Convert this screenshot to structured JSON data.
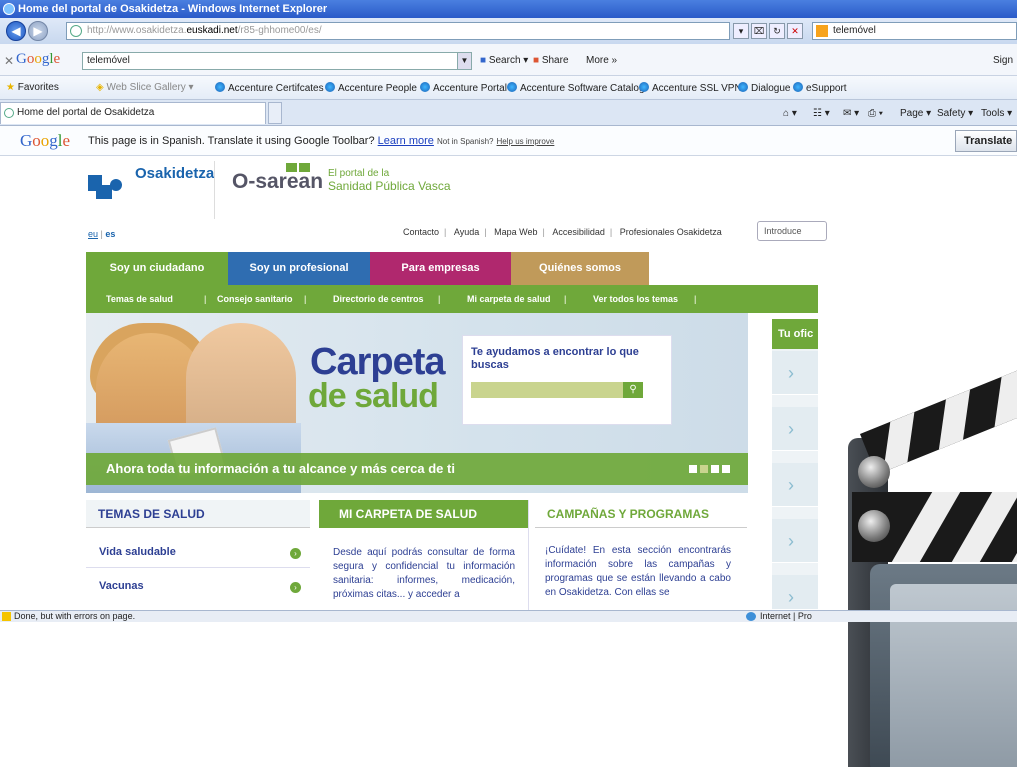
{
  "browser": {
    "title": "Home del portal de Osakidetza - Windows Internet Explorer",
    "url_prefix": "http://www.osakidetza.",
    "url_domain": "euskadi.net",
    "url_suffix": "/r85-ghhome00/es/",
    "search_value": "telemóvel",
    "tab_title": "Home del portal de Osakidetza",
    "status_text": "Done, but with errors on page.",
    "status_zone": "Internet | Pro"
  },
  "google_toolbar": {
    "logo": "Google",
    "query": "telemóvel",
    "search_label": "Search ▾",
    "share_label": "Share",
    "more_label": "More »",
    "sign_label": "Sign"
  },
  "favorites": {
    "label": "Favorites",
    "items": [
      "Web Slice Gallery ▾",
      "Accenture Certifcates",
      "Accenture People",
      "Accenture Portal",
      "Accenture Software Catalog",
      "Accenture SSL VPN",
      "Dialogue",
      "eSupport"
    ]
  },
  "command_bar": {
    "page": "Page ▾",
    "safety": "Safety ▾",
    "tools": "Tools ▾"
  },
  "translate_bar": {
    "logo": "Google",
    "message": "This page is in Spanish.  Translate it using Google Toolbar?",
    "learn_more": "Learn more",
    "not_spanish": "Not in Spanish?",
    "help": "Help us improve",
    "button": "Translate"
  },
  "portal": {
    "brand": "Osakidetza",
    "osarean": "O-sarean",
    "tag_line1": "El portal de la",
    "tag_line2": "Sanidad Pública Vasca",
    "lang_eu": "eu",
    "lang_es": "es",
    "top_links": [
      "Contacto",
      "Ayuda",
      "Mapa Web",
      "Accesibilidad",
      "Profesionales Osakidetza"
    ],
    "search_placeholder": "Introduce",
    "main_nav": [
      {
        "label": "Soy un ciudadano",
        "color": "#6fa83a"
      },
      {
        "label": "Soy un profesional",
        "color": "#2f6db1"
      },
      {
        "label": "Para empresas",
        "color": "#b0286e"
      },
      {
        "label": "Quiénes somos",
        "color": "#c09a5a"
      }
    ],
    "sub_nav": [
      "Temas de salud",
      "Consejo sanitario",
      "Directorio de centros",
      "Mi carpeta de salud",
      "Ver todos los temas"
    ],
    "hero": {
      "title_line1": "Carpeta",
      "title_line2": "de salud",
      "search_title": "Te ayudamos a encontrar lo que buscas",
      "band_text": "Ahora toda tu información a tu alcance y más cerca de ti"
    },
    "sidebar_title": "Tu ofic",
    "columns": {
      "temas": "TEMAS DE SALUD",
      "carpeta": "MI CARPETA DE SALUD",
      "campanas": "CAMPAÑAS Y PROGRAMAS"
    },
    "topics": [
      "Vida saludable",
      "Vacunas"
    ],
    "carpeta_text": "Desde aquí podrás consultar de forma segura y confidencial tu información sanitaria: informes, medicación, próximas citas... y acceder a",
    "campanas_text": "¡Cuídate! En esta sección encontrarás información sobre las campañas y programas que se están llevando a cabo en Osakidetza. Con ellas se"
  }
}
